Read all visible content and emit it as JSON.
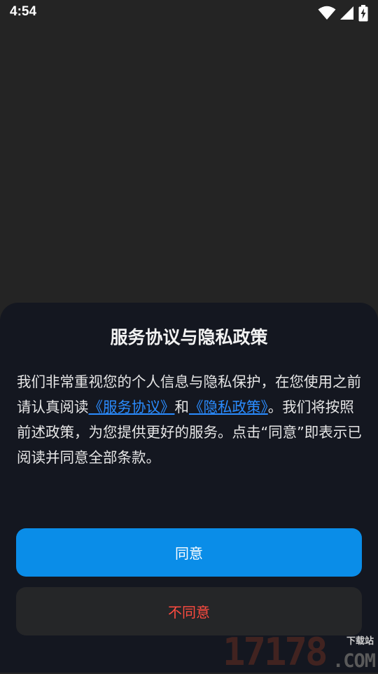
{
  "status_bar": {
    "time": "4:54",
    "icons": [
      "wifi-icon",
      "signal-icon",
      "battery-charging-icon"
    ]
  },
  "dialog": {
    "title": "服务协议与隐私政策",
    "body_part1": "我们非常重视您的个人信息与隐私保护，在您使用之前请认真阅读",
    "link_service": "《服务协议》",
    "conjunction": "和",
    "link_privacy": "《隐私政策》",
    "body_part2": "。我们将按照前述政策，为您提供更好的服务。点击“同意”即表示已阅读并同意全部条款。",
    "agree_label": "同意",
    "disagree_label": "不同意"
  },
  "watermark": {
    "big": "17178",
    "small": "下载站",
    "com": ".COM"
  },
  "colors": {
    "background": "#242424",
    "sheet": "#141720",
    "agree_button": "#0a8de8",
    "disagree_button": "#252628",
    "disagree_text": "#ff4b40",
    "link": "#2a8cff"
  }
}
